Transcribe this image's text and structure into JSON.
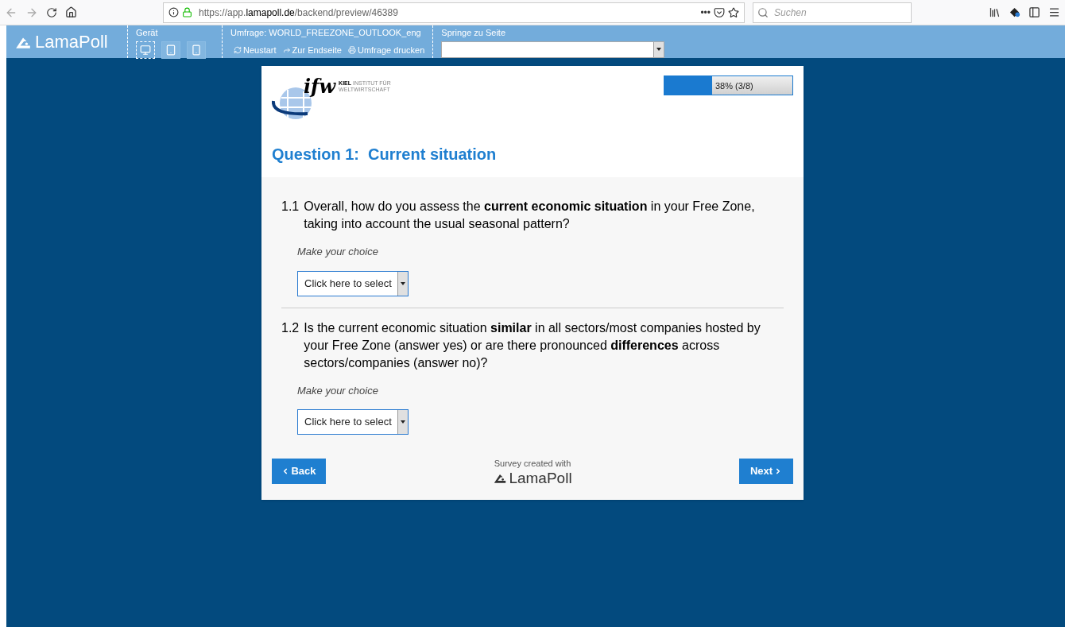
{
  "browser": {
    "url_prefix": "https://app.",
    "url_domain": "lamapoll.de",
    "url_path": "/backend/preview/46389",
    "more": "•••",
    "search_placeholder": "Suchen"
  },
  "toolbar": {
    "logo": "LamaPoll",
    "device_label": "Gerät",
    "devices": [
      {
        "kind": "desktop",
        "selected": true
      },
      {
        "kind": "tablet",
        "selected": false
      },
      {
        "kind": "phone",
        "selected": false
      }
    ],
    "survey_label": "Umfrage: WORLD_FREEZONE_OUTLOOK_eng",
    "actions": [
      {
        "kind": "restart",
        "label": "Neustart"
      },
      {
        "kind": "end",
        "label": "Zur Endseite"
      },
      {
        "kind": "print",
        "label": "Umfrage drucken"
      }
    ],
    "jump_label": "Springe zu Seite"
  },
  "survey": {
    "logo_kiel": "KIEL",
    "logo_line1": "INSTITUT FÜR",
    "logo_line2": "WELTWIRTSCHAFT",
    "logo_mark": "ifw",
    "progress": {
      "level": 0.375,
      "reading": "38% (3/8)"
    },
    "title": "Question 1:  Current situation",
    "questions": [
      {
        "number": "1.1",
        "text": "Overall, how do you assess the **current economic situation** in your Free Zone, taking into account the usual seasonal pattern?",
        "hint": "Make your choice",
        "select": "Click here to select"
      },
      {
        "number": "1.2",
        "text": "Is the current economic situation **similar** in all sectors/most companies hosted by your Free Zone (answer yes) or are there pronounced **differences** across sectors/companies (answer no)?",
        "hint": "Make your choice",
        "select": "Click here to select"
      }
    ],
    "back": "Back",
    "next": "Next",
    "credit": "Survey created with",
    "credit_logo": "LamaPoll"
  }
}
